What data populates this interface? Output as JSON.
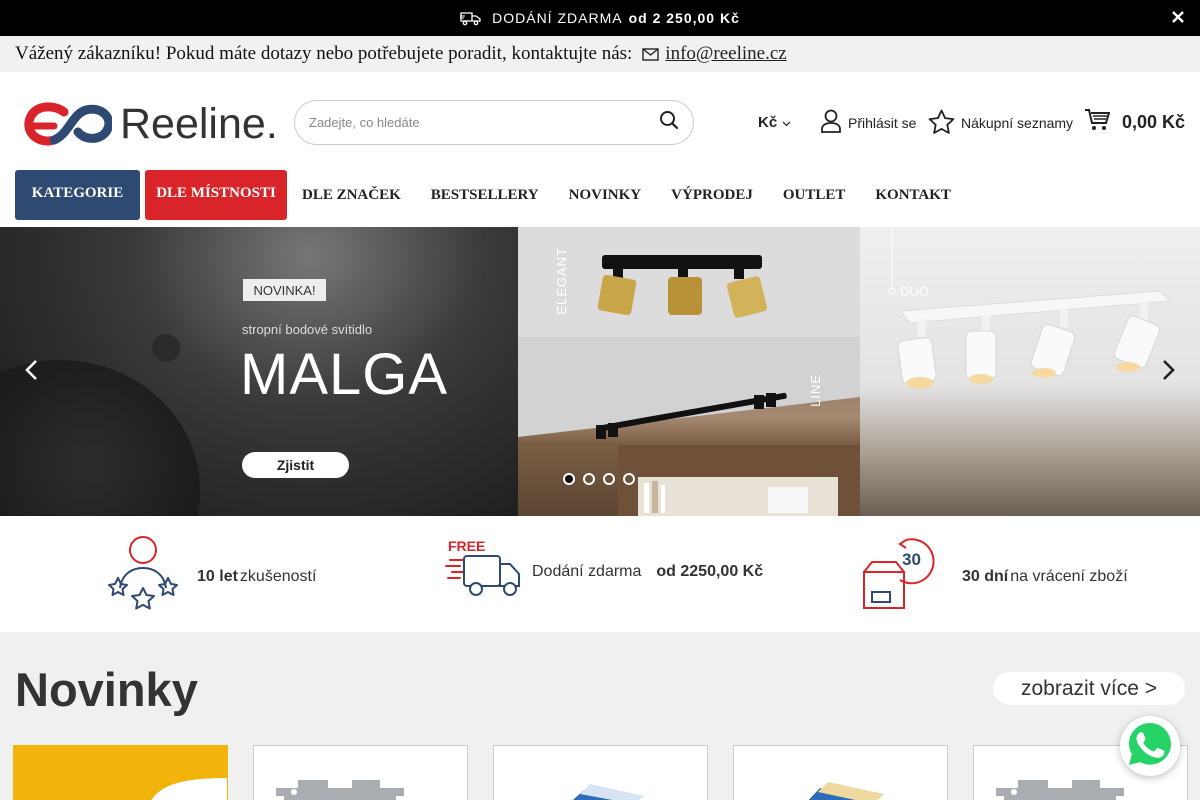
{
  "promo": {
    "text": "DODÁNÍ ZDARMA",
    "amount": "od 2 250,00 Kč"
  },
  "contact": {
    "text": "Vážený zákazníku! Pokud máte dotazy nebo potřebujete poradit, kontaktujte nás:",
    "email": "info@reeline.cz"
  },
  "header": {
    "logo_text": "Reeline.",
    "search_placeholder": "Zadejte, co hledáte",
    "currency": "Kč",
    "login_label": "Přihlásit se",
    "lists_label": "Nákupní seznamy",
    "cart_total": "0,00 Kč"
  },
  "nav": {
    "items": [
      "KATEGORIE",
      "DLE MÍSTNOSTI",
      "DLE ZNAČEK",
      "BESTSELLERY",
      "NOVINKY",
      "VÝPRODEJ",
      "OUTLET",
      "KONTAKT"
    ]
  },
  "hero": {
    "badge": "NOVINKA!",
    "subtitle": "stropní bodové svítidlo",
    "title": "MALGA",
    "button": "Zjistit",
    "label_elegant": "ELEGANT",
    "label_line": "LINE",
    "label_duo": "DUO",
    "slides": 4,
    "active_slide": 1
  },
  "benefits": [
    {
      "bold": "10 let",
      "text": "zkušeností"
    },
    {
      "text": "Dodání zdarma",
      "bold": "od 2250,00 Kč"
    },
    {
      "bold": "30 dní",
      "text": "na vrácení zboží"
    }
  ],
  "benefit_icons": {
    "free_label": "FREE",
    "return_days": "30"
  },
  "novinky": {
    "title": "Novinky",
    "more": "zobrazit více >"
  },
  "colors": {
    "nav_kategorie": "#2e4a72",
    "nav_mistnosti": "#d9252a",
    "logo_red": "#d9252a",
    "logo_blue": "#2e4a72"
  }
}
